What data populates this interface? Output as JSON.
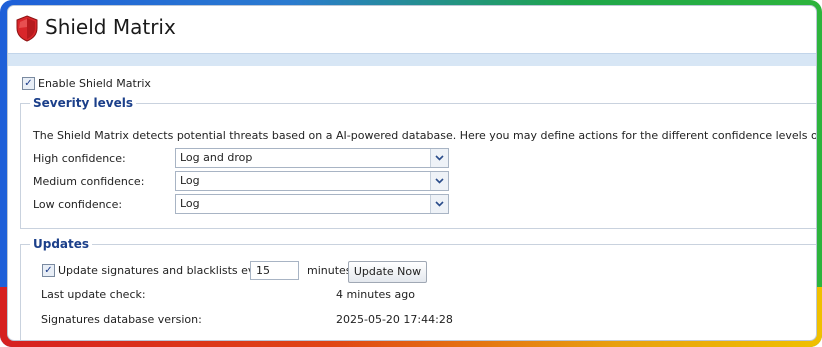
{
  "window": {
    "title": "Shield Matrix"
  },
  "enable": {
    "label": "Enable Shield Matrix",
    "checked": true
  },
  "severity": {
    "legend": "Severity levels",
    "description": "The Shield Matrix detects potential threats based on a AI-powered database. Here you may define actions for the different confidence levels of potential threats:",
    "rows": [
      {
        "label": "High confidence:",
        "value": "Log and drop"
      },
      {
        "label": "Medium confidence:",
        "value": "Log"
      },
      {
        "label": "Low confidence:",
        "value": "Log"
      }
    ]
  },
  "updates": {
    "legend": "Updates",
    "auto_update_label": "Update signatures and blacklists every",
    "auto_update_checked": true,
    "interval_value": "15",
    "interval_unit": "minutes",
    "update_now_label": "Update Now",
    "last_check_label": "Last update check:",
    "last_check_value": "4 minutes ago",
    "db_version_label": "Signatures database version:",
    "db_version_value": "2025-05-20 17:44:28"
  },
  "colors": {
    "legend": "#1b3f8a",
    "shield": "#d9262a",
    "strip": "#d7e6f5"
  },
  "icons": {
    "app": "shield-icon",
    "dropdown": "chevron-down-icon",
    "check": "checkmark-icon"
  }
}
